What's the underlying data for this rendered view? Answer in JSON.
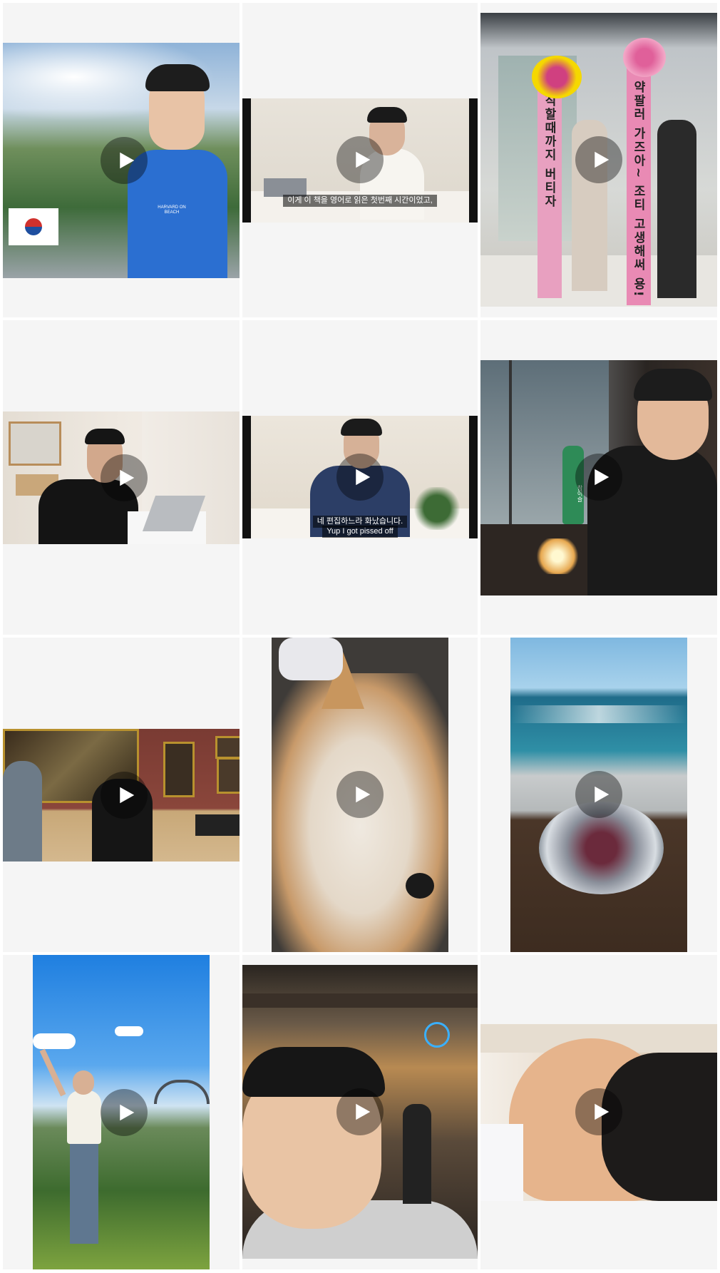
{
  "grid": {
    "thumbnails": [
      {
        "id": "post-1",
        "kind": "video",
        "shirt_text": "HARVARD ON BEACH"
      },
      {
        "id": "post-2",
        "kind": "video",
        "caption": "이게 이 책을 영어로 읽은 첫번째 시간이었고,"
      },
      {
        "id": "post-3",
        "kind": "video",
        "banner_left": "퇴직할때까지 버티자",
        "banner_right": "약팔러 가즈아~ 조티 고생해써 용!"
      },
      {
        "id": "post-4",
        "kind": "video"
      },
      {
        "id": "post-5",
        "kind": "video",
        "caption_ko": "네 편집하느라 화났습니다.",
        "caption_en": "Yup I got pissed off"
      },
      {
        "id": "post-6",
        "kind": "video",
        "bottle_label": "참이슬"
      },
      {
        "id": "post-7",
        "kind": "video"
      },
      {
        "id": "post-8",
        "kind": "video"
      },
      {
        "id": "post-9",
        "kind": "video"
      },
      {
        "id": "post-10",
        "kind": "video"
      },
      {
        "id": "post-11",
        "kind": "video"
      },
      {
        "id": "post-12",
        "kind": "video"
      }
    ]
  },
  "icons": {
    "play": "play-icon"
  },
  "colors": {
    "cell_background": "#f5f5f5",
    "play_overlay": "rgba(0,0,0,0.38)"
  }
}
